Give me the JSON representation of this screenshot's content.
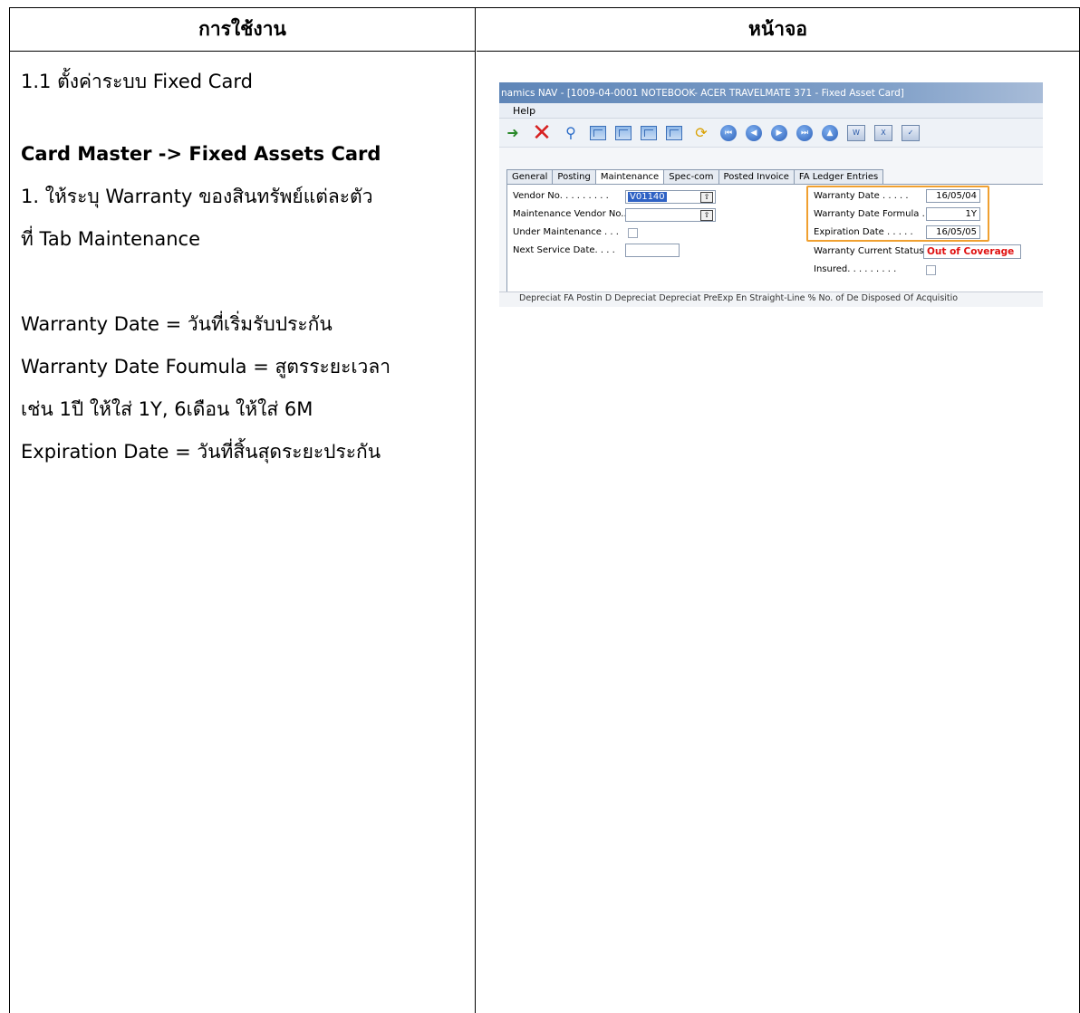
{
  "table": {
    "header_left": "การใช้งาน",
    "header_right": "หน้าจอ"
  },
  "left": {
    "line1": "1.1  ตั้งค่าระบบ Fixed Card",
    "line2": "Card Master -> Fixed Assets Card",
    "line3": "1. ให้ระบุ Warranty ของสินทรัพย์แต่ละตัว",
    "line4": "ที่ Tab Maintenance",
    "line5": "Warranty Date = วันที่เริ่มรับประกัน",
    "line6": "Warranty Date Foumula =  สูตรระยะเวลา",
    "line7": "เช่น 1ปี ให้ใส่ 1Y, 6เดือน ให้ใส่ 6M",
    "line8": "Expiration Date = วันที่สิ้นสุดระยะประกัน"
  },
  "nav": {
    "title": "namics NAV - [1009-04-0001 NOTEBOOK- ACER TRAVELMATE 371 - Fixed Asset Card]",
    "menu": "Help",
    "tabs": [
      "General",
      "Posting",
      "Maintenance",
      "Spec-com",
      "Posted Invoice",
      "FA Ledger Entries"
    ],
    "active_tab": "Maintenance",
    "fields": {
      "vendor_no_label": "Vendor No. . . . . . . . .",
      "vendor_no_value": "V01140",
      "maint_vendor_label": "Maintenance Vendor No..",
      "under_maint_label": "Under Maintenance . . .",
      "next_service_label": "Next Service Date. . . .",
      "warranty_date_label": "Warranty Date . . . . .",
      "warranty_date_value": "16/05/04",
      "warranty_formula_label": "Warranty Date Formula .",
      "warranty_formula_value": "1Y",
      "expiration_label": "Expiration Date . . . . .",
      "expiration_value": "16/05/05",
      "status_label": "Warranty Current Status",
      "status_value": "Out of Coverage",
      "insured_label": "Insured. . . . . . . . ."
    },
    "grid_header": "Depreciat    FA Postin    D    Depreciat    Depreciat    PreExp En    Straight-Line %   No. of De    Disposed Of   Acquisitio",
    "colors": {
      "accent": "#f0a030",
      "status_red": "#e01010",
      "title_blue": "#5f86b8"
    }
  }
}
